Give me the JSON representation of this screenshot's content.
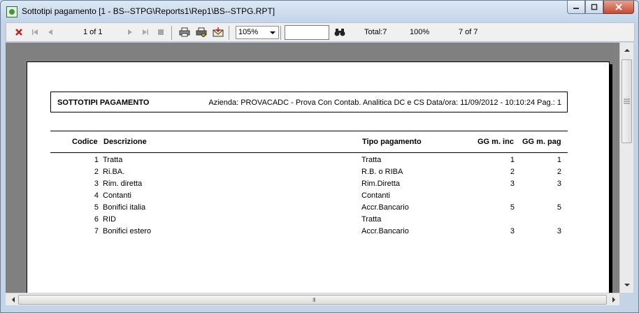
{
  "window": {
    "title": "Sottotipi pagamento [1 - BS--STPG\\Reports1\\Rep1\\BS--STPG.RPT]",
    "minimize_icon": "minimize-icon",
    "maximize_icon": "maximize-icon",
    "close_icon": "close-icon"
  },
  "toolbar": {
    "page_of": "1 of 1",
    "zoom": "105%",
    "search_value": "",
    "total": "Total:7",
    "percent": "100%",
    "records": "7 of 7"
  },
  "report": {
    "title": "SOTTOTIPI PAGAMENTO",
    "info": "Azienda: PROVACADC - Prova Con Contab. Analitica DC e CS  Data/ora:  11/09/2012 - 10:10:24   Pag.: 1",
    "columns": {
      "codice": "Codice",
      "descrizione": "Descrizione",
      "tipo": "Tipo pagamento",
      "gg_inc": "GG m. inc",
      "gg_pag": "GG m. pag"
    },
    "rows": [
      {
        "codice": "1",
        "descrizione": "Tratta",
        "tipo": "Tratta",
        "gg_inc": "1",
        "gg_pag": "1"
      },
      {
        "codice": "2",
        "descrizione": "Ri.BA.",
        "tipo": "R.B. o RIBA",
        "gg_inc": "2",
        "gg_pag": "2"
      },
      {
        "codice": "3",
        "descrizione": "Rim. diretta",
        "tipo": "Rim.Diretta",
        "gg_inc": "3",
        "gg_pag": "3"
      },
      {
        "codice": "4",
        "descrizione": "Contanti",
        "tipo": "Contanti",
        "gg_inc": "",
        "gg_pag": ""
      },
      {
        "codice": "5",
        "descrizione": "Bonifici italia",
        "tipo": "Accr.Bancario",
        "gg_inc": "5",
        "gg_pag": "5"
      },
      {
        "codice": "6",
        "descrizione": "RID",
        "tipo": "Tratta",
        "gg_inc": "",
        "gg_pag": ""
      },
      {
        "codice": "7",
        "descrizione": "Bonifici estero",
        "tipo": "Accr.Bancario",
        "gg_inc": "3",
        "gg_pag": "3"
      }
    ]
  },
  "scrollbars": {
    "up_icon": "arrow-up-icon",
    "down_icon": "arrow-down-icon",
    "left_icon": "arrow-left-icon",
    "right_icon": "arrow-right-icon",
    "grip": "III"
  }
}
